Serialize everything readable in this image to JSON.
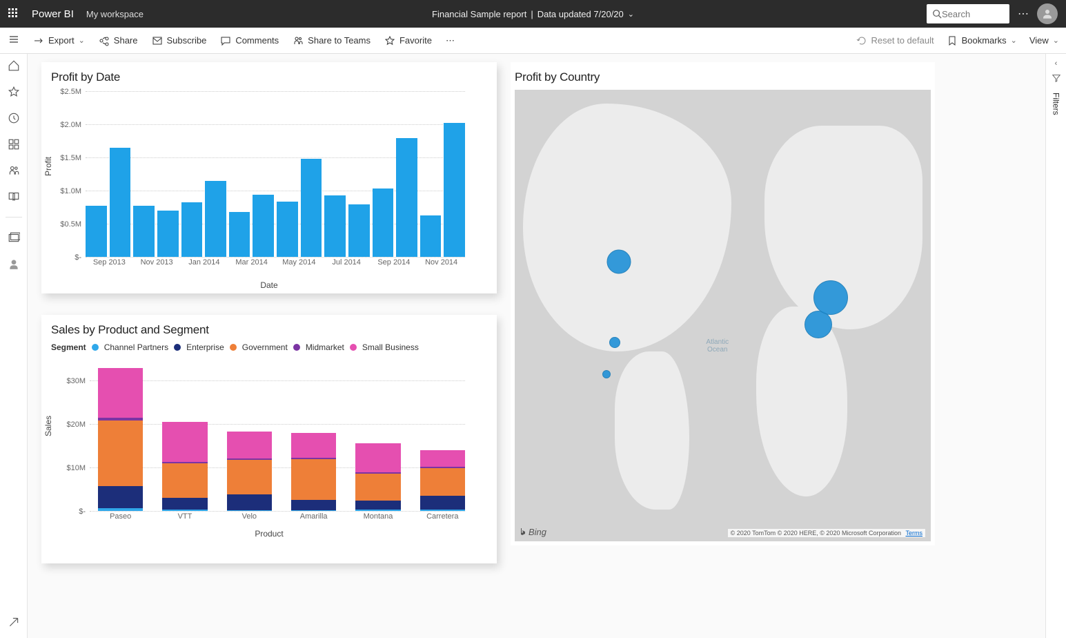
{
  "top": {
    "app": "Power BI",
    "workspace": "My workspace",
    "report_title": "Financial Sample report",
    "data_updated": "Data updated 7/20/20",
    "search_placeholder": "Search",
    "more": "⋯"
  },
  "cmdbar": {
    "export": "Export",
    "share": "Share",
    "subscribe": "Subscribe",
    "comments": "Comments",
    "share_teams": "Share to Teams",
    "favorite": "Favorite",
    "more": "⋯",
    "reset": "Reset to default",
    "bookmarks": "Bookmarks",
    "view": "View"
  },
  "right_rail": {
    "filters": "Filters"
  },
  "visuals": {
    "profit_by_date": {
      "title": "Profit by Date",
      "xlabel": "Date",
      "ylabel": "Profit"
    },
    "sales_by_product": {
      "title": "Sales by Product and Segment",
      "legend_title": "Segment",
      "xlabel": "Product",
      "ylabel": "Sales"
    },
    "profit_by_country": {
      "title": "Profit by Country",
      "bing": "Bing",
      "attrib": "© 2020 TomTom © 2020 HERE, © 2020 Microsoft Corporation",
      "terms": "Terms"
    }
  },
  "chart_data": [
    {
      "id": "profit_by_date",
      "type": "bar",
      "title": "Profit by Date",
      "xlabel": "Date",
      "ylabel": "Profit",
      "ylim": [
        0,
        2500000
      ],
      "y_ticks": [
        "$-",
        "$0.5M",
        "$1.0M",
        "$1.5M",
        "$2.0M",
        "$2.5M"
      ],
      "x_ticks": [
        "Sep 2013",
        "Nov 2013",
        "Jan 2014",
        "Mar 2014",
        "May 2014",
        "Jul 2014",
        "Sep 2014",
        "Nov 2014"
      ],
      "categories": [
        "Sep 2013",
        "Oct 2013",
        "Nov 2013",
        "Dec 2013",
        "Jan 2014",
        "Feb 2014",
        "Mar 2014",
        "Apr 2014",
        "May 2014",
        "Jun 2014",
        "Jul 2014",
        "Aug 2014",
        "Sep 2014",
        "Oct 2014",
        "Nov 2014",
        "Dec 2014"
      ],
      "values": [
        770000,
        1650000,
        770000,
        700000,
        820000,
        1150000,
        680000,
        940000,
        830000,
        1480000,
        930000,
        790000,
        1030000,
        1790000,
        620000,
        2020000
      ]
    },
    {
      "id": "sales_by_product_segment",
      "type": "bar",
      "stacked": true,
      "title": "Sales by Product and Segment",
      "xlabel": "Product",
      "ylabel": "Sales",
      "ylim": [
        0,
        35000000
      ],
      "y_ticks": [
        "$-",
        "$10M",
        "$20M",
        "$30M"
      ],
      "categories": [
        "Paseo",
        "VTT",
        "Velo",
        "Amarilla",
        "Montana",
        "Carretera"
      ],
      "series": [
        {
          "name": "Channel Partners",
          "color": "#30a8ea",
          "values": [
            600000,
            250000,
            200000,
            200000,
            250000,
            250000
          ]
        },
        {
          "name": "Enterprise",
          "color": "#1c2e7a",
          "values": [
            5200000,
            2700000,
            3700000,
            2300000,
            2100000,
            3200000
          ]
        },
        {
          "name": "Government",
          "color": "#ee7f38",
          "values": [
            15100000,
            8100000,
            7900000,
            9500000,
            6300000,
            6400000
          ]
        },
        {
          "name": "Midmarket",
          "color": "#7b34a3",
          "values": [
            600000,
            250000,
            300000,
            300000,
            300000,
            300000
          ]
        },
        {
          "name": "Small Business",
          "color": "#e54fb0",
          "values": [
            11500000,
            9200000,
            6200000,
            5700000,
            6600000,
            3900000
          ]
        }
      ]
    },
    {
      "id": "profit_by_country",
      "type": "map",
      "title": "Profit by Country",
      "bubbles": [
        {
          "country": "Canada",
          "lat": 56,
          "lon": -106,
          "size": 35
        },
        {
          "country": "United States",
          "lat": 38,
          "lon": -97,
          "size": 16
        },
        {
          "country": "Mexico",
          "lat": 23,
          "lon": -102,
          "size": 12
        },
        {
          "country": "France",
          "lat": 47,
          "lon": 2,
          "size": 40
        },
        {
          "country": "Germany",
          "lat": 51,
          "lon": 10,
          "size": 50
        }
      ]
    }
  ]
}
